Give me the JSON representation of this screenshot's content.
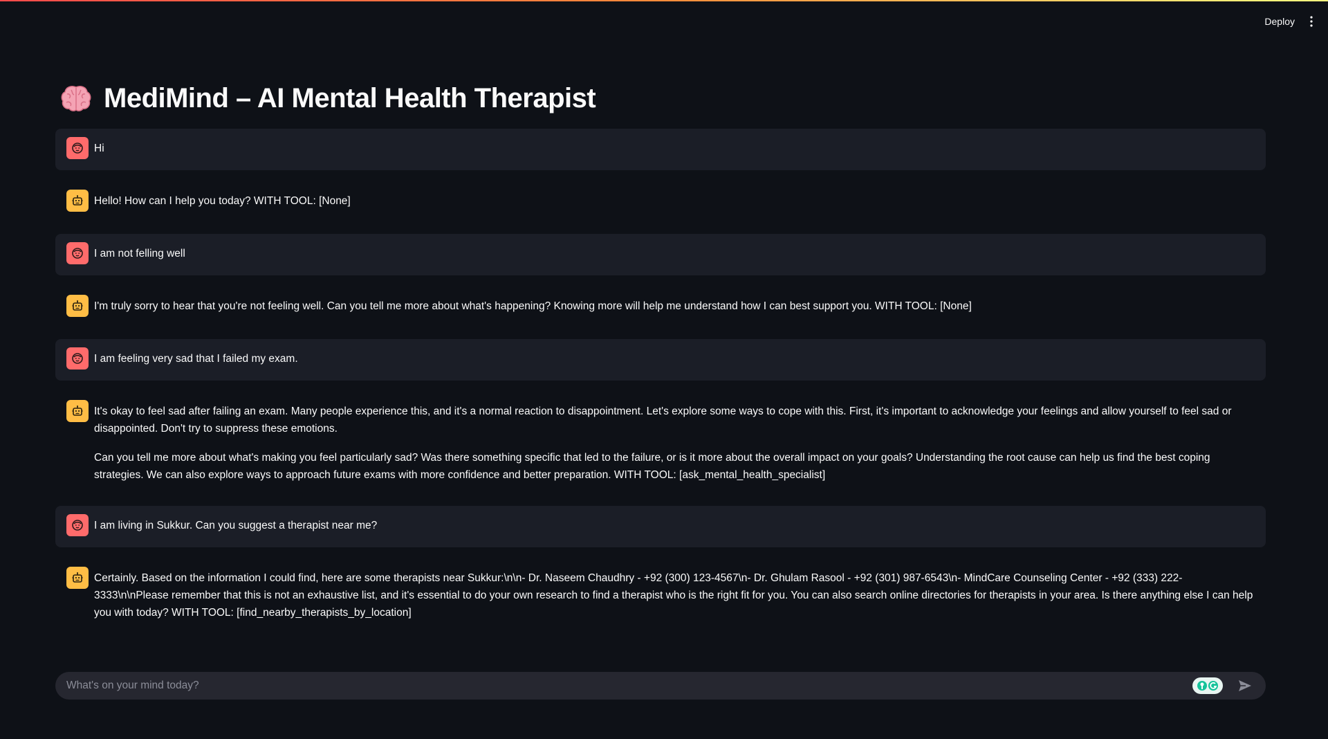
{
  "header": {
    "deploy_label": "Deploy",
    "menu_icon": "kebab-menu-icon",
    "gradient_colors": [
      "#ff4b4b",
      "#ff8c3a",
      "#fffd80"
    ]
  },
  "page": {
    "title": "MediMind – AI Mental Health Therapist",
    "title_icon": "brain-icon"
  },
  "colors": {
    "background": "#0e1117",
    "user_message_bg": "#1b1e27",
    "user_avatar": "#ff6b6b",
    "assistant_avatar": "#ffbd45",
    "input_bg": "#262730"
  },
  "messages": [
    {
      "role": "user",
      "paragraphs": [
        "Hi"
      ]
    },
    {
      "role": "assistant",
      "paragraphs": [
        "Hello! How can I help you today? WITH TOOL: [None]"
      ]
    },
    {
      "role": "user",
      "paragraphs": [
        "I am not felling well"
      ]
    },
    {
      "role": "assistant",
      "paragraphs": [
        "I'm truly sorry to hear that you're not feeling well. Can you tell me more about what's happening? Knowing more will help me understand how I can best support you. WITH TOOL: [None]"
      ]
    },
    {
      "role": "user",
      "paragraphs": [
        "I am feeling very sad that I failed my exam."
      ]
    },
    {
      "role": "assistant",
      "paragraphs": [
        "It's okay to feel sad after failing an exam. Many people experience this, and it's a normal reaction to disappointment. Let's explore some ways to cope with this. First, it's important to acknowledge your feelings and allow yourself to feel sad or disappointed. Don't try to suppress these emotions.",
        "Can you tell me more about what's making you feel particularly sad? Was there something specific that led to the failure, or is it more about the overall impact on your goals? Understanding the root cause can help us find the best coping strategies. We can also explore ways to approach future exams with more confidence and better preparation. WITH TOOL: [ask_mental_health_specialist]"
      ]
    },
    {
      "role": "user",
      "paragraphs": [
        "I am living in Sukkur. Can you suggest a therapist near me?"
      ]
    },
    {
      "role": "assistant",
      "paragraphs": [
        "Certainly. Based on the information I could find, here are some therapists near Sukkur:\\n\\n- Dr. Naseem Chaudhry - +92 (300) 123-4567\\n- Dr. Ghulam Rasool - +92 (301) 987-6543\\n- MindCare Counseling Center - +92 (333) 222-3333\\n\\nPlease remember that this is not an exhaustive list, and it's essential to do your own research to find a therapist who is the right fit for you. You can also search online directories for therapists in your area. Is there anything else I can help you with today? WITH TOOL: [find_nearby_therapists_by_location]"
      ]
    }
  ],
  "chat_input": {
    "placeholder": "What's on your mind today?",
    "value": "",
    "grammarly_icon": "grammarly-icon",
    "send_icon": "send-icon"
  }
}
